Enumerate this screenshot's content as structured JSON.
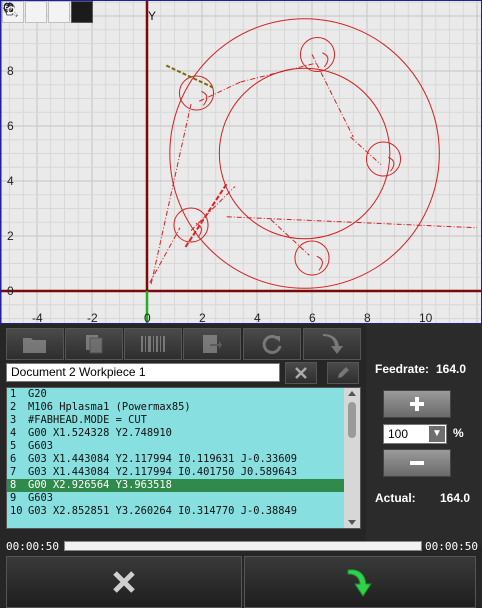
{
  "plot": {
    "y_axis_label": "Y",
    "x_ticks": [
      "-4",
      "-2",
      "0",
      "2",
      "4",
      "6",
      "8",
      "10"
    ],
    "y_ticks": [
      "8",
      "6",
      "4",
      "2",
      "0"
    ]
  },
  "toolbar": {
    "icons": [
      "hand-icon",
      "zoom-in-icon",
      "zoom-fit-icon",
      "zoom-select-icon"
    ]
  },
  "document": {
    "title": "Document 2 Workpiece 1"
  },
  "code": {
    "lines": [
      {
        "n": "1",
        "text": "G20"
      },
      {
        "n": "2",
        "text": "M106 Hplasma1 (Powermax85)"
      },
      {
        "n": "3",
        "text": "#FABHEAD.MODE = CUT"
      },
      {
        "n": "4",
        "text": "G00 X1.524328 Y2.748910"
      },
      {
        "n": "5",
        "text": "G603"
      },
      {
        "n": "6",
        "text": "G03 X1.443084 Y2.117994 I0.119631 J-0.33609"
      },
      {
        "n": "7",
        "text": "G03 X1.443084 Y2.117994 I0.401750 J0.589643"
      },
      {
        "n": "8",
        "text": "G00 X2.926564 Y3.963518"
      },
      {
        "n": "9",
        "text": "G603"
      },
      {
        "n": "10",
        "text": "G03 X2.852851 Y3.260264 I0.314770 J-0.38849"
      }
    ],
    "selected_line": "8"
  },
  "feed": {
    "feedrate_label": "Feedrate:",
    "feedrate_value": "164.0",
    "override_value": "100",
    "percent_sign": "%",
    "actual_label": "Actual:",
    "actual_value": "164.0"
  },
  "progress": {
    "elapsed": "00:00:50",
    "remaining": "00:00:50",
    "fraction": 0
  }
}
